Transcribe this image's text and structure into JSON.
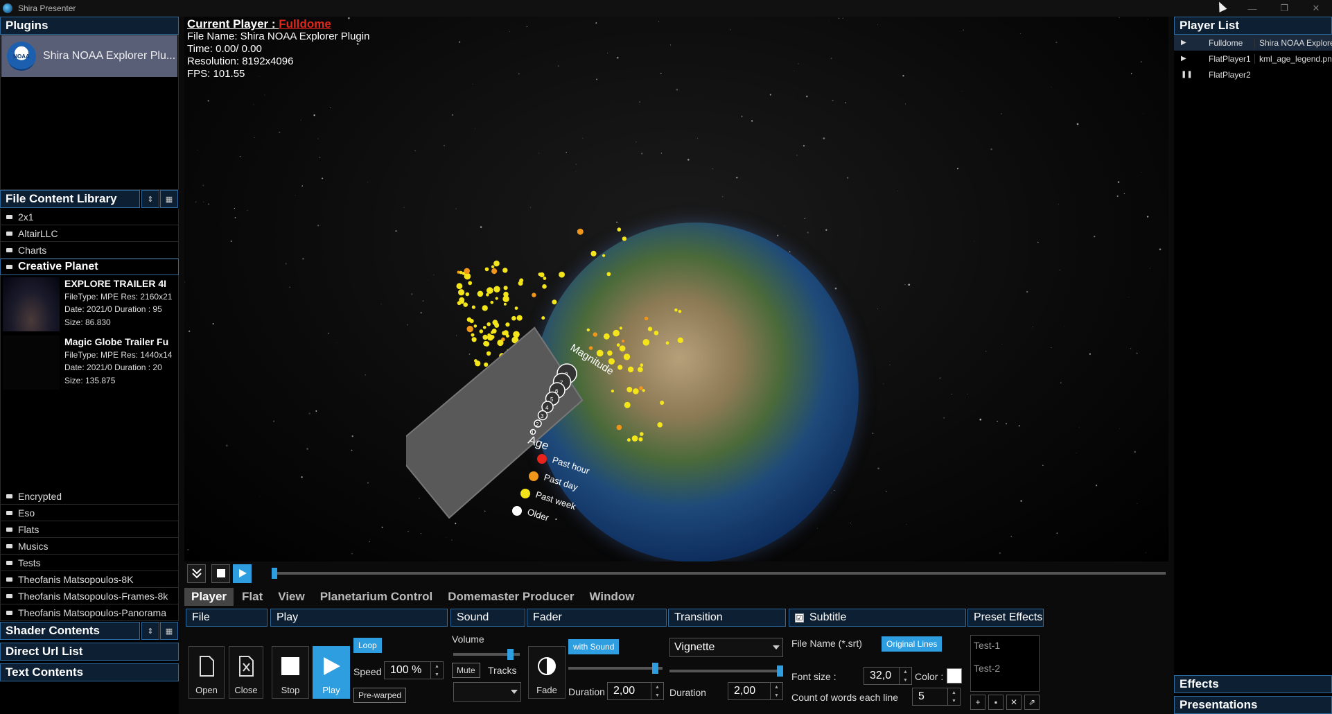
{
  "window": {
    "title": "Shira Presenter",
    "buttons": [
      "—",
      "❐",
      "✕"
    ]
  },
  "plugins": {
    "header": "Plugins",
    "items": [
      {
        "label": "Shira NOAA Explorer Plu...",
        "logo_text": "NOAA"
      }
    ]
  },
  "library": {
    "header": "File Content Library",
    "folders_top": [
      "2x1",
      "AltairLLC",
      "Charts"
    ],
    "open_folder": "Creative Planet",
    "media": [
      {
        "title": "EXPLORE TRAILER 4I",
        "filetype": "FileType: MPE",
        "res": "Res: 2160x21",
        "date": "Date: 2021/0",
        "duration": "Duration : 95",
        "size": "Size: 86.830"
      },
      {
        "title": "Magic Globe Trailer Fu",
        "filetype": "FileType: MPE",
        "res": "Res: 1440x14",
        "date": "Date: 2021/0",
        "duration": "Duration : 20",
        "size": "Size: 135.875"
      }
    ],
    "folders_bottom": [
      "Encrypted",
      "Eso",
      "Flats",
      "Musics",
      "Tests",
      "Theofanis Matsopoulos-8K",
      "Theofanis Matsopoulos-Frames-8k",
      "Theofanis Matsopoulos-Panorama"
    ]
  },
  "left_sections": {
    "shader": "Shader Contents",
    "url": "Direct Url List",
    "text": "Text Contents"
  },
  "viewport": {
    "current_player_label": "Current Player : ",
    "current_player_value": "Fulldome",
    "file_name": "File Name: Shira NOAA Explorer Plugin",
    "time": "Time: 0.00/ 0.00",
    "resolution": "Resolution: 8192x4096",
    "fps": "FPS: 101.55",
    "legend": {
      "magnitude": "Magnitude",
      "magnitude_ticks": [
        "8",
        "7",
        "6",
        "5",
        "4",
        "3",
        "2",
        "1"
      ],
      "age": "Age",
      "age_items": [
        {
          "label": "Past hour",
          "color": "#e8231c"
        },
        {
          "label": "Past day",
          "color": "#f0961a"
        },
        {
          "label": "Past week",
          "color": "#f4e41a"
        },
        {
          "label": "Older",
          "color": "#ffffff"
        }
      ]
    },
    "seek_progress": 0
  },
  "tabs": [
    "Player",
    "Flat",
    "View",
    "Planetarium Control",
    "Domemaster Producer",
    "Window"
  ],
  "active_tab": "Player",
  "controls": {
    "file": {
      "header": "File",
      "open": "Open",
      "close": "Close"
    },
    "play": {
      "header": "Play",
      "stop": "Stop",
      "play": "Play",
      "loop": "Loop",
      "speed_label": "Speed",
      "speed_value": "100 %",
      "prewarped": "Pre-warped"
    },
    "sound": {
      "header": "Sound",
      "volume_label": "Volume",
      "volume_level": 0.9,
      "mute": "Mute",
      "tracks_label": "Tracks",
      "tracks_value": ""
    },
    "fader": {
      "header": "Fader",
      "fade": "Fade",
      "with_sound": "with Sound",
      "level": 0.95,
      "duration_label": "Duration",
      "duration_value": "2,00"
    },
    "transition": {
      "header": "Transition",
      "effect": "Vignette",
      "level": 1.0,
      "duration_label": "Duration",
      "duration_value": "2,00"
    },
    "subtitle": {
      "header": "Subtitle",
      "checkbox": "☑",
      "file_name_label": "File Name (*.srt)",
      "original_lines": "Original Lines",
      "font_size_label": "Font size :",
      "font_size_value": "32,0",
      "color_label": "Color :",
      "color_value": "#ffffff",
      "words_label": "Count of words each line",
      "words_value": "5"
    },
    "preset": {
      "header": "Preset Effects",
      "items": [
        "Test-1",
        "Test-2"
      ],
      "icons": [
        "+",
        "▪",
        "✕",
        "⇗"
      ]
    }
  },
  "player_list": {
    "header": "Player List",
    "rows": [
      {
        "state": "▶",
        "name": "Fulldome",
        "file": "Shira NOAA Explorer"
      },
      {
        "state": "▶",
        "name": "FlatPlayer1",
        "file": "kml_age_legend.png"
      },
      {
        "state": "❚❚",
        "name": "FlatPlayer2",
        "file": ""
      }
    ]
  },
  "right_sections": {
    "effects": "Effects",
    "presentations": "Presentations"
  }
}
